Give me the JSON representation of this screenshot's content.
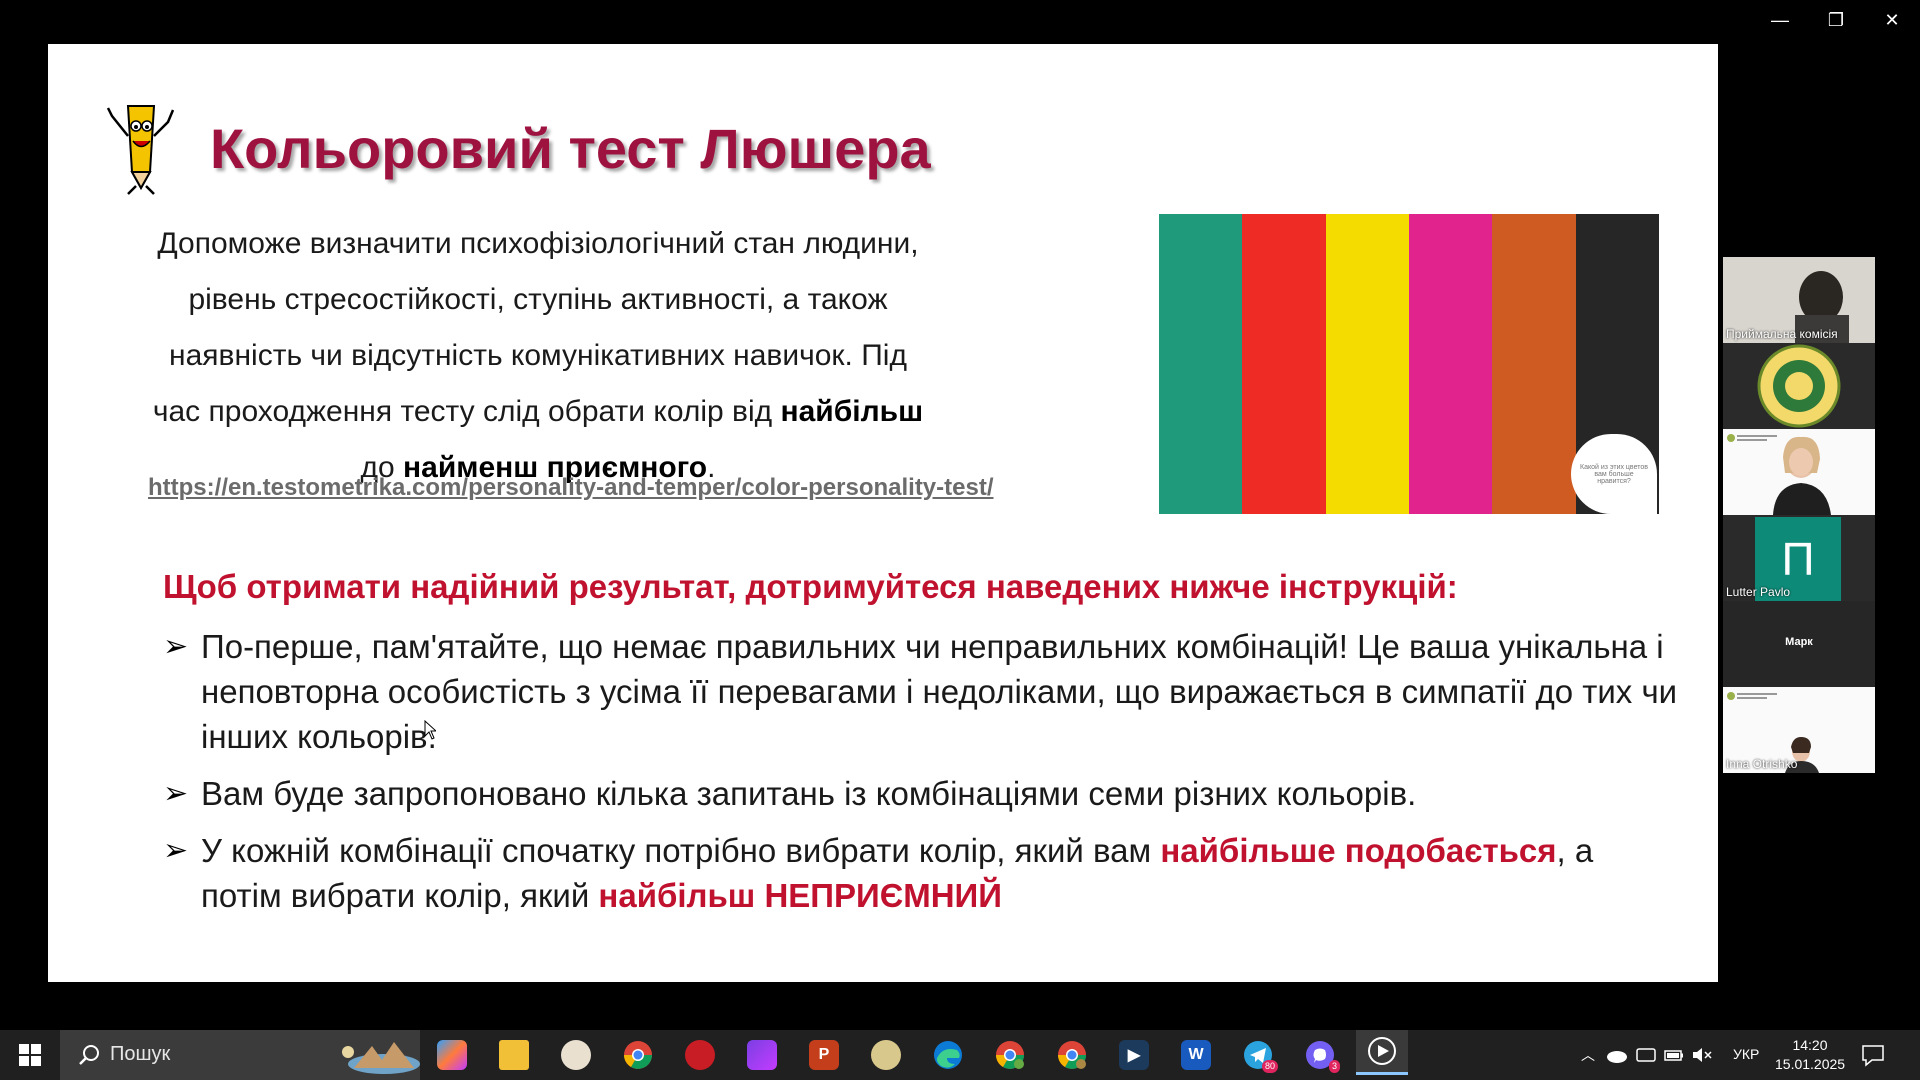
{
  "window": {
    "minimize": "—",
    "restore": "❐",
    "close": "✕"
  },
  "slide": {
    "title": "Кольоровий тест Люшера",
    "intro_part1": "Допоможе визначити психофізіологічний стан людини, рівень стресостійкості, ступінь активності, а також наявність чи відсутність комунікативних навичок. Під час проходження тесту слід обрати колір від ",
    "intro_bold1": "найбільш",
    "intro_part2": " до ",
    "intro_bold2": "найменш приємного",
    "intro_part3": ".",
    "link": "https://en.testometrika.com/personality-and-temper/color-personality-test/",
    "palette_colors": [
      "#1f9a7a",
      "#ee2b24",
      "#f4dc00",
      "#e0238d",
      "#cf5a22",
      "#262626"
    ],
    "bubble_text": "Какой из этих цветов вам больше нравится?",
    "heading": "Щоб отримати надійний результат, дотримуйтеся наведених нижче інструкцій:",
    "bullet1": "По-перше, пам'ятайте, що немає правильних чи неправильних комбінацій! Це ваша унікальна і неповторна особистість з усіма її перевагами і недоліками, що виражається в симпатії до тих чи інших кольорів.",
    "bullet2": "Вам буде запропоновано кілька запитань із комбінаціями семи різних кольорів.",
    "bullet3_part1": "У кожній комбінації спочатку потрібно вибрати колір, який вам ",
    "bullet3_red1": "найбільше подобається",
    "bullet3_part2": ", а потім вибрати колір, який ",
    "bullet3_red2": "найбільш НЕПРИЄМНИЙ",
    "bullet_marker": "➢"
  },
  "participants": [
    {
      "name": "Приймальна комісія"
    },
    {
      "name": ""
    },
    {
      "name": ""
    },
    {
      "name": "Lutter Pavlo",
      "initial": "П"
    },
    {
      "name": "",
      "center": "Марк"
    },
    {
      "name": "Inna Otrishko"
    }
  ],
  "taskbar": {
    "search_placeholder": "Пошук",
    "apps": [
      "copilot",
      "file-explorer",
      "paint",
      "chrome",
      "security-app",
      "clipchamp",
      "powerpoint",
      "chrome-profile",
      "edge",
      "chrome-profile-2",
      "chrome-profile-3",
      "media-app",
      "word",
      "telegram",
      "viber",
      "video-player"
    ],
    "telegram_badge": "80",
    "viber_badge": "3",
    "language": "УКР",
    "time": "14:20",
    "date": "15.01.2025"
  }
}
